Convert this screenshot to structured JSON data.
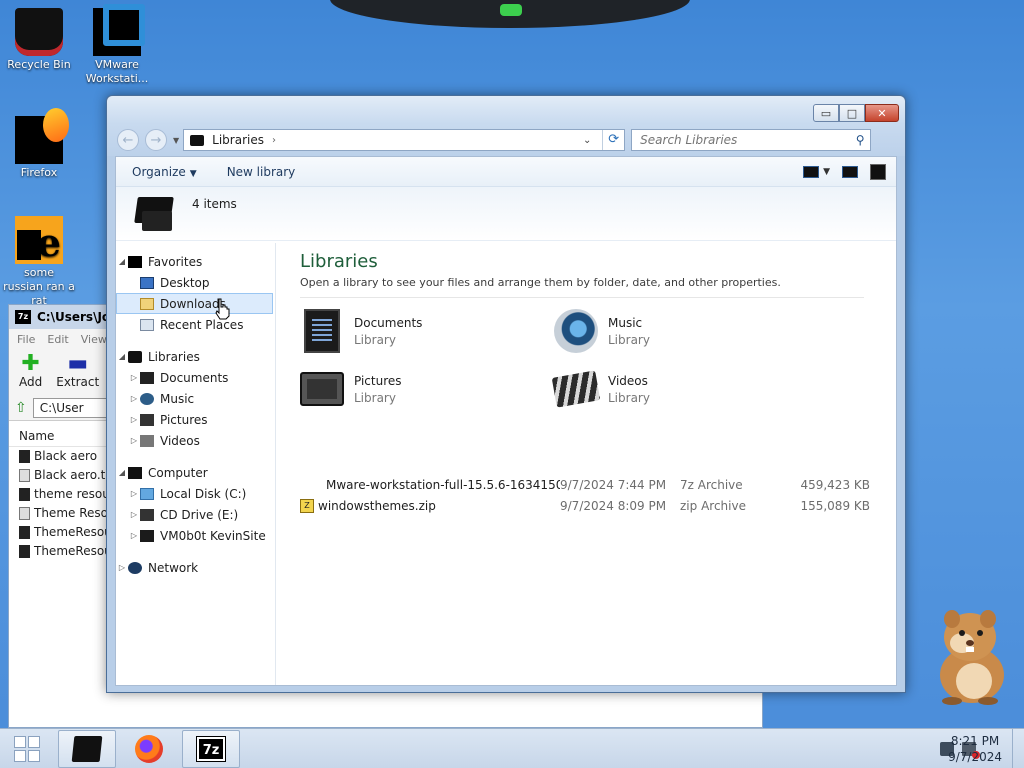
{
  "desktop": {
    "icons": [
      {
        "label": "Recycle Bin"
      },
      {
        "label": "VMware Workstati..."
      },
      {
        "label": "Firefox"
      },
      {
        "label": "some russian ran a rat"
      }
    ]
  },
  "zip_window": {
    "title": "C:\\Users\\Jose",
    "menu": [
      "File",
      "Edit",
      "View"
    ],
    "tools": [
      "Add",
      "Extract"
    ],
    "path": "C:\\User",
    "column_name": "Name",
    "files": [
      "Black aero",
      "Black aero.the",
      "theme resour",
      "Theme Resou",
      "ThemeResour",
      "ThemeResour"
    ]
  },
  "explorer": {
    "address_crumb": "Libraries",
    "search_placeholder": "Search Libraries",
    "cmd": {
      "organize": "Organize",
      "new_library": "New library"
    },
    "item_count": "4 items",
    "nav": {
      "favorites": "Favorites",
      "desktop": "Desktop",
      "downloads": "Downloads",
      "recent": "Recent Places",
      "libraries": "Libraries",
      "documents": "Documents",
      "music": "Music",
      "pictures": "Pictures",
      "videos": "Videos",
      "computer": "Computer",
      "local_disk": "Local Disk (C:)",
      "cd_drive": "CD Drive (E:)",
      "vm_share": "VM0b0t KevinSite",
      "network": "Network"
    },
    "content": {
      "heading": "Libraries",
      "subheading": "Open a library to see your files and arrange them by folder, date, and other properties.",
      "libraries": [
        {
          "name": "Documents",
          "type": "Library"
        },
        {
          "name": "Music",
          "type": "Library"
        },
        {
          "name": "Pictures",
          "type": "Library"
        },
        {
          "name": "Videos",
          "type": "Library"
        }
      ],
      "files": [
        {
          "name": "Mware-workstation-full-15.5.6-1634150...",
          "date": "9/7/2024 7:44 PM",
          "type": "7z Archive",
          "size": "459,423 KB"
        },
        {
          "name": "windowsthemes.zip",
          "date": "9/7/2024 8:09 PM",
          "type": "zip Archive",
          "size": "155,089 KB"
        }
      ]
    }
  },
  "taskbar": {
    "time": "8:21 PM",
    "date": "9/7/2024",
    "zip_label": "7z"
  },
  "colors": {
    "desktop_bg": "#4a8cd9",
    "heading_green": "#1e5e3a",
    "close_red": "#c5432c"
  }
}
